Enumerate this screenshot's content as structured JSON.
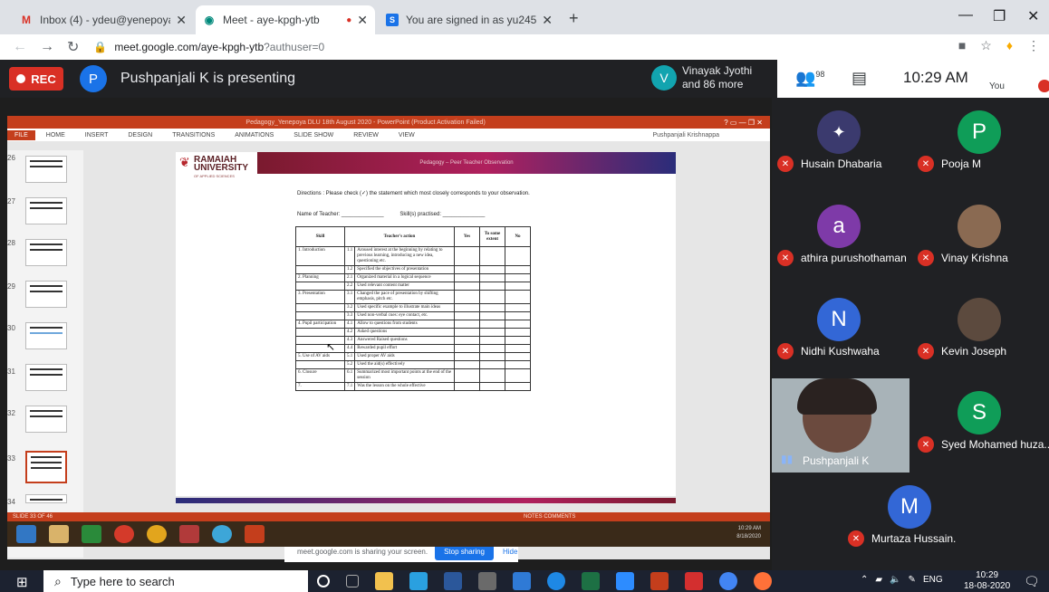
{
  "browser": {
    "tabs": [
      {
        "label": "Inbox (4) - ydeu@yenepoya.edu",
        "favicon": "M"
      },
      {
        "label": "Meet - aye-kpgh-ytb",
        "favicon": "meet-icon"
      },
      {
        "label": "You are signed in as yu2455",
        "favicon": "S"
      }
    ],
    "url": "meet.google.com/aye-kpgh-ytb",
    "url_suffix": "?authuser=0"
  },
  "meet": {
    "rec_label": "REC",
    "presenter_initial": "P",
    "presenting_text": "Pushpanjali K is presenting",
    "viewer_initial": "V",
    "viewer_line1": "Vinayak Jyothi",
    "viewer_line2": "and 86 more",
    "people_count": "98",
    "time": "10:29 AM",
    "you_label": "You"
  },
  "presentation": {
    "ppt_title": "Pedagogy_Yenepoya DLU 18th August 2020 - PowerPoint (Product Activation Failed)",
    "ribbon": [
      "FILE",
      "HOME",
      "INSERT",
      "DESIGN",
      "TRANSITIONS",
      "ANIMATIONS",
      "SLIDE SHOW",
      "REVIEW",
      "VIEW"
    ],
    "ribbon_user": "Pushpanjali Krishnappa",
    "slide_numbers": [
      "26",
      "27",
      "28",
      "29",
      "30",
      "31",
      "32",
      "33",
      "34"
    ],
    "logo_line1": "RAMAIAH",
    "logo_line2": "UNIVERSITY",
    "logo_sub": "OF APPLIED SCIENCES",
    "banner_text": "Pedagogy – Peer Teacher Observation",
    "directions": "Directions : Please check (✓) the statement which most closely corresponds to your observation.",
    "name_teacher": "Name of Teacher: ______________",
    "skills_practised": "Skill(s) practised: ______________",
    "table_headers": [
      "Skill",
      "Teacher's action",
      "",
      "Yes",
      "To some extent",
      "No"
    ],
    "rows": [
      {
        "skill": "1. Introduction",
        "num": "1.1",
        "action": "Aroused interest at the beginning by relating to previous learning, introducing a new idea, questioning etc."
      },
      {
        "skill": "",
        "num": "1.2",
        "action": "Specified the objectives of presentation"
      },
      {
        "skill": "2. Planning",
        "num": "2.1",
        "action": "Organized material in a logical sequence"
      },
      {
        "skill": "",
        "num": "2.2",
        "action": "Used relevant content matter"
      },
      {
        "skill": "3. Presentation",
        "num": "3.1",
        "action": "Changed the pace of presentation by shifting emphasis, pitch etc."
      },
      {
        "skill": "",
        "num": "3.2",
        "action": "Used specific example to illustrate main ideas"
      },
      {
        "skill": "",
        "num": "3.3",
        "action": "Used non-verbal cues: eye contact, etc."
      },
      {
        "skill": "4. Pupil participation",
        "num": "4.1",
        "action": "Allow to questions from students"
      },
      {
        "skill": "",
        "num": "4.2",
        "action": "Asked questions"
      },
      {
        "skill": "",
        "num": "4.3",
        "action": "Answered Raised questions"
      },
      {
        "skill": "",
        "num": "4.4",
        "action": "Rewarded pupil effort"
      },
      {
        "skill": "5. Use of AV aids",
        "num": "5.1",
        "action": "Used proper AV aids"
      },
      {
        "skill": "",
        "num": "5.2",
        "action": "Used the aid(s) effectively"
      },
      {
        "skill": "6. Closure",
        "num": "6.1",
        "action": "Summarized most important points at the end of the session"
      },
      {
        "skill": "7.",
        "num": "7.1",
        "action": "Was the lesson on the whole effective"
      }
    ],
    "share_text": "meet.google.com is sharing your screen.",
    "stop_sharing": "Stop sharing",
    "hide": "Hide",
    "status_left": "SLIDE 33 OF 46",
    "status_right": "NOTES   COMMENTS",
    "inner_time": "10:29 AM",
    "inner_date": "8/18/2020"
  },
  "participants": [
    {
      "name": "Husain Dhabaria",
      "initial": "",
      "color": "#3b3a6e"
    },
    {
      "name": "Pooja M",
      "initial": "P",
      "color": "#0f9d58"
    },
    {
      "name": "athira purushothaman",
      "initial": "a",
      "color": "#7e3aa8"
    },
    {
      "name": "Vinay Krishna",
      "initial": "",
      "color": "#8a6a52"
    },
    {
      "name": "Nidhi Kushwaha",
      "initial": "N",
      "color": "#3367d6"
    },
    {
      "name": "Kevin Joseph",
      "initial": "",
      "color": "#5c4a3e"
    },
    {
      "name": "Syed Mohamed huza..",
      "initial": "S",
      "color": "#0f9d58"
    },
    {
      "name": "Murtaza Hussain.",
      "initial": "M",
      "color": "#3367d6"
    }
  ],
  "presenter_tile_name": "Pushpanjali K",
  "taskbar": {
    "search_placeholder": "Type here to search",
    "lang": "ENG",
    "time": "10:29",
    "date": "18-08-2020"
  }
}
